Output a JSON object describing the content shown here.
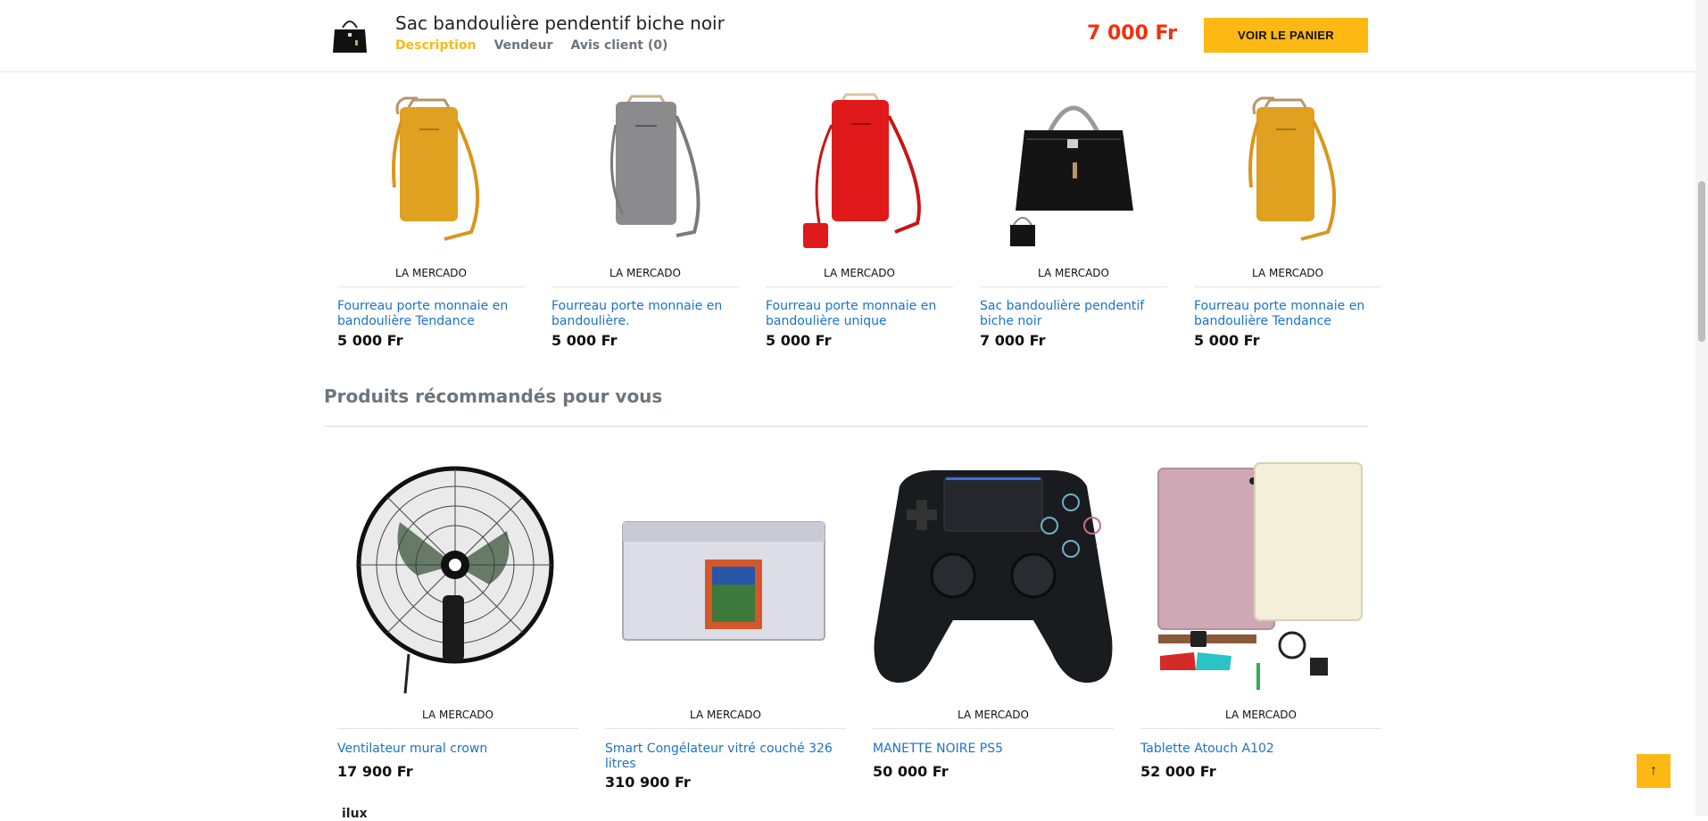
{
  "header": {
    "title": "Sac bandoulière pendentif biche noir",
    "tabs": [
      {
        "label": "Description",
        "active": true
      },
      {
        "label": "Vendeur",
        "active": false
      },
      {
        "label": "Avis client (0)",
        "active": false
      }
    ],
    "price": "7 000 Fr",
    "cart_button": "VOIR LE PANIER",
    "price_color": "#f3300c",
    "accent_color": "#fdb813"
  },
  "similar_products": [
    {
      "vendor": "LA MERCADO",
      "name": "Fourreau porte monnaie en bandoulière Tendance",
      "price": "5 000 Fr",
      "image": "yellow-phone-bag"
    },
    {
      "vendor": "LA MERCADO",
      "name": "Fourreau porte monnaie en bandoulière.",
      "price": "5 000 Fr",
      "image": "grey-phone-bag"
    },
    {
      "vendor": "LA MERCADO",
      "name": "Fourreau porte monnaie en bandoulière unique",
      "price": "5 000 Fr",
      "image": "red-phone-bag"
    },
    {
      "vendor": "LA MERCADO",
      "name": "Sac bandoulière pendentif biche noir",
      "price": "7 000 Fr",
      "image": "black-handbag"
    },
    {
      "vendor": "LA MERCADO",
      "name": "Fourreau porte monnaie en bandoulière Tendance",
      "price": "5 000 Fr",
      "image": "yellow-phone-bag"
    }
  ],
  "recommended": {
    "title": "Produits récommandés pour vous",
    "products": [
      {
        "vendor": "LA MERCADO",
        "name": "Ventilateur mural crown",
        "price": "17 900 Fr",
        "image": "wall-fan"
      },
      {
        "vendor": "LA MERCADO",
        "name": "Smart Congélateur vitré couché 326 litres",
        "price": "310 900 Fr",
        "image": "chest-freezer"
      },
      {
        "vendor": "LA MERCADO",
        "name": "MANETTE NOIRE PS5",
        "price": "50 000 Fr",
        "image": "game-controller"
      },
      {
        "vendor": "LA MERCADO",
        "name": "Tablette Atouch A102",
        "price": "52 000 Fr",
        "image": "tablet-kit"
      }
    ]
  },
  "footer_peek": "ilux",
  "back_to_top": "↑"
}
